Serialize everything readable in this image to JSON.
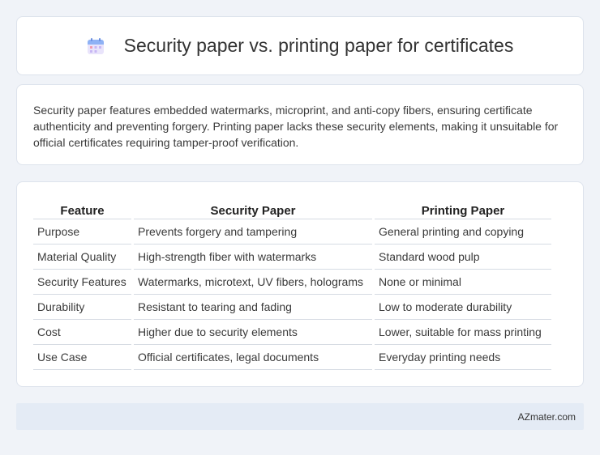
{
  "header": {
    "title": "Security paper vs. printing paper for certificates",
    "icon": "calendar-icon"
  },
  "summary": {
    "text": "Security paper features embedded watermarks, microprint, and anti-copy fibers, ensuring certificate authenticity and preventing forgery. Printing paper lacks these security elements, making it unsuitable for official certificates requiring tamper-proof verification."
  },
  "table": {
    "headers": [
      "Feature",
      "Security Paper",
      "Printing Paper"
    ],
    "rows": [
      [
        "Purpose",
        "Prevents forgery and tampering",
        "General printing and copying"
      ],
      [
        "Material Quality",
        "High-strength fiber with watermarks",
        "Standard wood pulp"
      ],
      [
        "Security Features",
        "Watermarks, microtext, UV fibers, holograms",
        "None or minimal"
      ],
      [
        "Durability",
        "Resistant to tearing and fading",
        "Low to moderate durability"
      ],
      [
        "Cost",
        "Higher due to security elements",
        "Lower, suitable for mass printing"
      ],
      [
        "Use Case",
        "Official certificates, legal documents",
        "Everyday printing needs"
      ]
    ]
  },
  "footer": {
    "brand": "AZmater.com"
  }
}
